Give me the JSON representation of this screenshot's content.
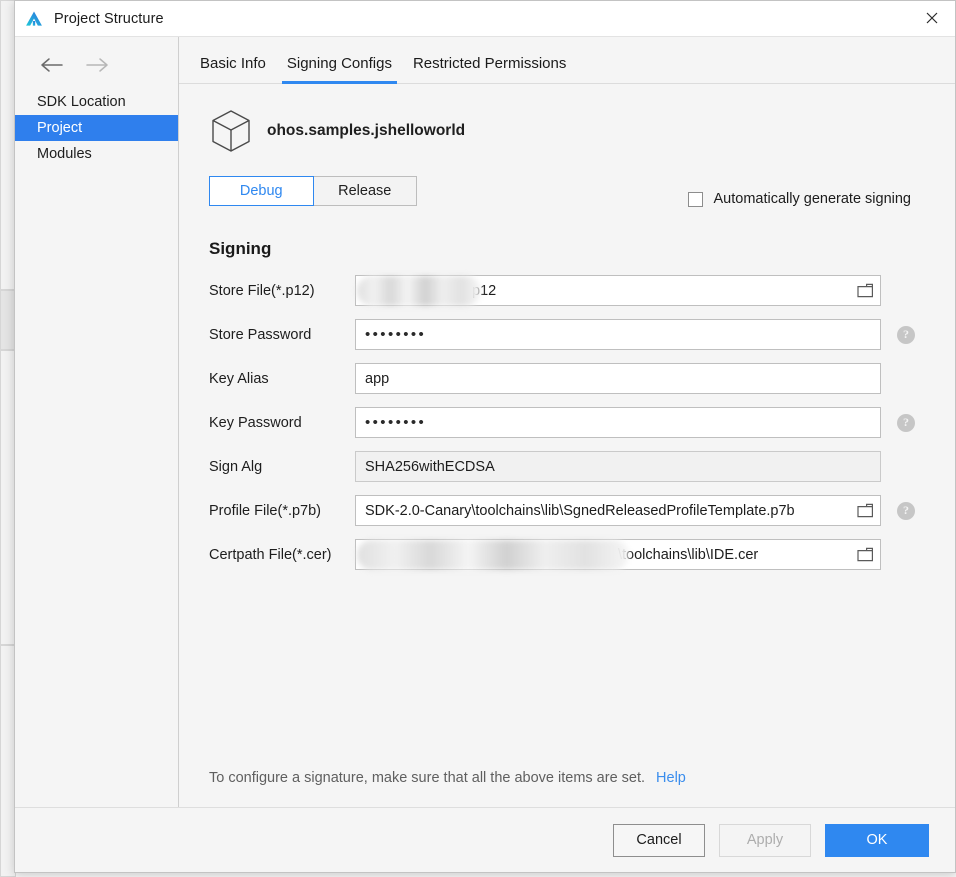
{
  "window": {
    "title": "Project Structure",
    "logo_icon": "deveco-studio-logo-icon",
    "close_icon": "close-icon"
  },
  "nav": {
    "back_icon": "arrow-left-icon",
    "forward_icon": "arrow-right-icon",
    "items": [
      {
        "label": "SDK Location",
        "selected": false
      },
      {
        "label": "Project",
        "selected": true
      },
      {
        "label": "Modules",
        "selected": false
      }
    ]
  },
  "tabs": [
    {
      "label": "Basic Info",
      "active": false
    },
    {
      "label": "Signing Configs",
      "active": true
    },
    {
      "label": "Restricted Permissions",
      "active": false
    }
  ],
  "package": {
    "icon": "cube-package-icon",
    "name": "ohos.samples.jshelloworld"
  },
  "build_variants": [
    {
      "label": "Debug",
      "active": true
    },
    {
      "label": "Release",
      "active": false
    }
  ],
  "auto_generate": {
    "label": "Automatically generate signing",
    "checked": false
  },
  "section": {
    "title": "Signing"
  },
  "fields": [
    {
      "label": "Store File(*.p12)",
      "value": "p12",
      "masked": false,
      "redacted": true,
      "browse": true,
      "browse_icon": "folder-open-icon",
      "help": false,
      "readonly": false
    },
    {
      "label": "Store Password",
      "value": "••••••••",
      "masked": true,
      "redacted": false,
      "browse": false,
      "help": true,
      "help_icon": "help-circle-icon",
      "readonly": false
    },
    {
      "label": "Key Alias",
      "value": "app",
      "masked": false,
      "redacted": false,
      "browse": false,
      "help": false,
      "readonly": false
    },
    {
      "label": "Key Password",
      "value": "••••••••",
      "masked": true,
      "redacted": false,
      "browse": false,
      "help": true,
      "help_icon": "help-circle-icon",
      "readonly": false
    },
    {
      "label": "Sign Alg",
      "value": "SHA256withECDSA",
      "masked": false,
      "redacted": false,
      "browse": false,
      "help": false,
      "readonly": true
    },
    {
      "label": "Profile File(*.p7b)",
      "value": "SDK-2.0-Canary\\toolchains\\lib\\SgnedReleasedProfileTemplate.p7b",
      "masked": false,
      "redacted": false,
      "browse": true,
      "browse_icon": "folder-open-icon",
      "help": true,
      "help_icon": "help-circle-icon",
      "readonly": false
    },
    {
      "label": "Certpath File(*.cer)",
      "value": "\\toolchains\\lib\\IDE.cer",
      "masked": false,
      "redacted": true,
      "browse": true,
      "browse_icon": "folder-open-icon",
      "help": true,
      "help_icon": "help-circle-icon",
      "readonly": false
    }
  ],
  "note": {
    "text": "To configure a signature, make sure that all the above items are set.",
    "link": "Help"
  },
  "buttons": {
    "cancel": "Cancel",
    "apply": "Apply",
    "ok": "OK"
  },
  "colors": {
    "accent": "#2f88f0",
    "selection": "#2f7fed",
    "link": "#3a8ded",
    "window_bg": "#f5f5f5",
    "field_bg": "#ffffff"
  }
}
